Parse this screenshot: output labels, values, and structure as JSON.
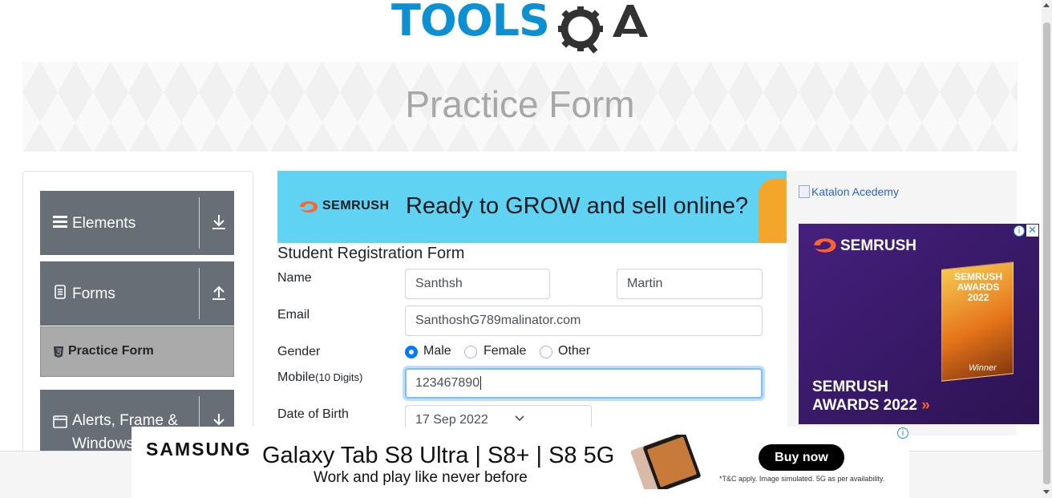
{
  "logo": {
    "text_left": "TOOLS",
    "text_right": "QA"
  },
  "banner": {
    "title": "Practice Form"
  },
  "sidebar": {
    "groups": [
      {
        "label": "Elements",
        "icon": "hamburger-icon",
        "expanded": false
      },
      {
        "label": "Forms",
        "icon": "document-icon",
        "expanded": true
      },
      {
        "label_line1": "Alerts, Frame &",
        "label_line2": "Windows",
        "icon": "window-icon",
        "expanded": false
      }
    ],
    "active_item": {
      "label": "Practice Form",
      "icon": "html5-icon"
    }
  },
  "top_ad": {
    "brand": "SEMRUSH",
    "tagline": "Ready to GROW and sell online?"
  },
  "form": {
    "title": "Student Registration Form",
    "name_label": "Name",
    "first_name": "Santhsh",
    "last_name": "Martin",
    "email_label": "Email",
    "email_value": "SanthoshG789malinator.com",
    "gender_label": "Gender",
    "gender_options": [
      "Male",
      "Female",
      "Other"
    ],
    "gender_selected": "Male",
    "mobile_label": "Mobile",
    "mobile_hint": "(10 Digits)",
    "mobile_value": "123467890",
    "dob_label": "Date of Birth",
    "dob_value": "17 Sep 2022"
  },
  "right_ads": {
    "katalon_alt": "Katalon Acedemy",
    "brand": "SEMRUSH",
    "trophy_text": "SEMRUSH AWARDS 2022",
    "winner": "Winner",
    "award_line1": "SEMRUSH",
    "award_line2": "AWARDS 2022",
    "award_arrow": "»"
  },
  "bottom_ad": {
    "brand": "SAMSUNG",
    "headline": "Galaxy Tab S8 Ultra | S8+ | S8 5G",
    "subline": "Work and play like never before",
    "button": "Buy now",
    "fineprint": "*T&C apply. Image simulated. 5G as per availability."
  },
  "colors": {
    "brand_blue": "#0d90d2",
    "sidebar_group": "#686e76",
    "active_item": "#aaaaaa",
    "semrush_bg": "#5fd3f1",
    "focus_ring": "#80bdff"
  }
}
